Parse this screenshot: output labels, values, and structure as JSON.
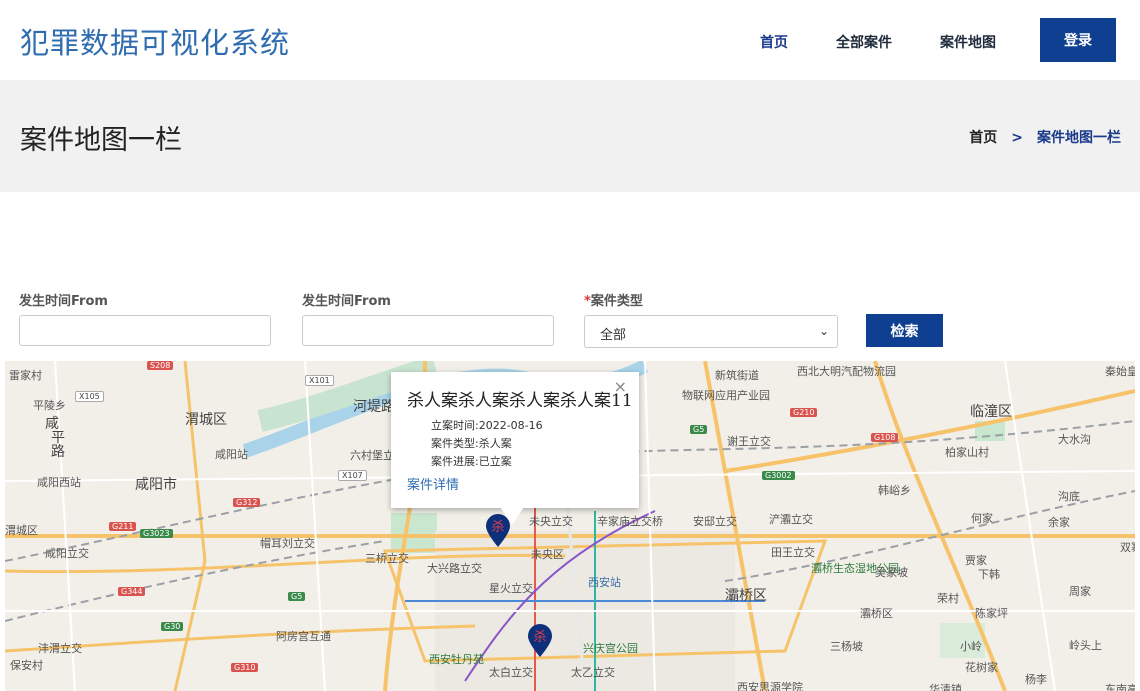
{
  "header": {
    "logo": "犯罪数据可视化系统",
    "nav": [
      "首页",
      "全部案件",
      "案件地图"
    ],
    "login": "登录"
  },
  "banner": {
    "title": "案件地图一栏",
    "breadcrumb": [
      "首页",
      ">",
      "案件地图一栏"
    ]
  },
  "filter": {
    "from_label": "发生时间From",
    "to_label": "发生时间From",
    "type_required": "*",
    "type_label": "案件类型",
    "type_value": "全部",
    "search": "检索"
  },
  "popup": {
    "title": "杀人案杀人案杀人案杀人案11",
    "close": "×",
    "date": "立案时间:2022-08-16",
    "type": "案件类型:杀人案",
    "progress": "案件进展:已立案",
    "link": "案件详情"
  },
  "markers": [
    {
      "label": "杀"
    },
    {
      "label": "杀"
    }
  ],
  "map_labels": [
    "雷家村",
    "平陵乡",
    "咸",
    "平",
    "路",
    "渭城区",
    "咸阳站",
    "咸阳西站",
    "咸阳市",
    "渭城区",
    "咸阳立交",
    "河堤路",
    "六村堡立交",
    "帽耳刘立交",
    "三桥立交",
    "大兴路立交",
    "星火立交",
    "未央立交",
    "未央区",
    "辛家庙立交桥",
    "安邸立交",
    "浐灞立交",
    "田王立交",
    "灞桥生态湿地公园",
    "灞桥区",
    "西安站",
    "兴庆宫公园",
    "太白立交",
    "太乙立交",
    "西安牡丹苑",
    "阿房宫互通",
    "沣渭立交",
    "保安村",
    "物联网应用产业园",
    "谢王立交",
    "新筑街道",
    "西北大明汽配物流园",
    "临潼区",
    "秦始皇兵马俑",
    "大水沟",
    "柏家山村",
    "韩峪乡",
    "何家",
    "余家",
    "沟底",
    "吴家坡",
    "贾家",
    "下韩",
    "荣村",
    "陈家坪",
    "周家",
    "花树家",
    "杨李",
    "华清镇",
    "西安思源学院",
    "三杨坡",
    "小岭",
    "岭头上",
    "灞桥区",
    "双寨庄村",
    "东南高"
  ]
}
